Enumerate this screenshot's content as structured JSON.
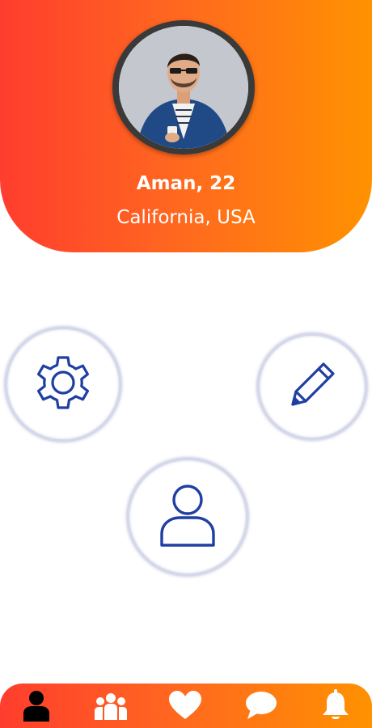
{
  "profile": {
    "name": "Aman, 22",
    "location": "California, USA",
    "avatar": "profile-photo"
  },
  "actions": [
    {
      "icon": "gear-icon",
      "id": "settings"
    },
    {
      "icon": "pencil-icon",
      "id": "edit"
    },
    {
      "icon": "user-icon",
      "id": "profile"
    }
  ],
  "bottom_nav": {
    "items": [
      {
        "icon": "user-icon",
        "active": true
      },
      {
        "icon": "group-icon",
        "active": false
      },
      {
        "icon": "heart-icon",
        "active": false
      },
      {
        "icon": "chat-icon",
        "active": false
      },
      {
        "icon": "bell-icon",
        "active": false
      }
    ]
  },
  "colors": {
    "gradient_start": "#ff3d2e",
    "gradient_end": "#ff9200",
    "icon_blue": "#1f3fa3",
    "nav_active": "#000000",
    "nav_inactive": "#ffffff"
  }
}
